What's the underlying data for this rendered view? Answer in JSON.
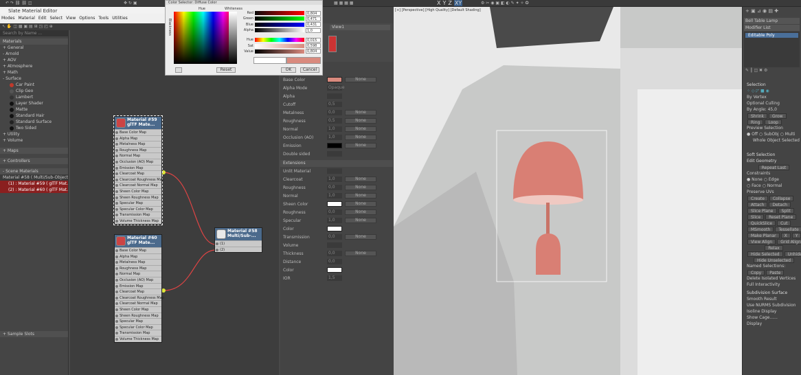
{
  "toolbar": {
    "axes": [
      "X",
      "Y",
      "Z",
      "XY"
    ]
  },
  "window_title": "Slate Material Editor",
  "menu": [
    "Modes",
    "Material",
    "Edit",
    "Select",
    "View",
    "Options",
    "Tools",
    "Utilities"
  ],
  "browser": {
    "search": "Search by Name ...",
    "items": [
      {
        "label": "Materials",
        "type": "section"
      },
      {
        "label": "+ General",
        "type": "item"
      },
      {
        "label": "- Arnold",
        "type": "item"
      },
      {
        "label": "+ AOV",
        "type": "item"
      },
      {
        "label": "+ Atmosphere",
        "type": "item"
      },
      {
        "label": "+ Math",
        "type": "item"
      },
      {
        "label": "- Surface",
        "type": "item"
      },
      {
        "label": "Car Paint",
        "type": "mat",
        "color": "#c0392b"
      },
      {
        "label": "Clip Geo",
        "type": "mat",
        "color": "#555"
      },
      {
        "label": "Lambert",
        "type": "mat",
        "color": "#333"
      },
      {
        "label": "Layer Shader",
        "type": "mat",
        "color": "#111"
      },
      {
        "label": "Matte",
        "type": "mat",
        "color": "#111"
      },
      {
        "label": "Standard Hair",
        "type": "mat",
        "color": "#111"
      },
      {
        "label": "Standard Surface",
        "type": "mat",
        "color": "#222"
      },
      {
        "label": "Two Sided",
        "type": "mat",
        "color": "#111"
      },
      {
        "label": "+ Utility",
        "type": "item"
      },
      {
        "label": "+ Volume",
        "type": "item"
      },
      {
        "label": "+ Maps",
        "type": "section"
      },
      {
        "label": "+ Controllers",
        "type": "section"
      },
      {
        "label": "- Scene Materials",
        "type": "section"
      },
      {
        "label": "Material #58 ( Multi/Sub-Object )",
        "type": "scene"
      },
      {
        "label": "(1) : Material #59 ( glTF Mat...",
        "type": "scene-red"
      },
      {
        "label": "(2) : Material #60 ( glTF Mat...",
        "type": "scene-red"
      }
    ],
    "sample_slots": "+ Sample Slots"
  },
  "view_tab": "View1",
  "color_picker": {
    "title": "Color Selector: Diffuse Color",
    "hue_label": "Hue",
    "whiteness_label": "Whiteness",
    "blackness_label": "Blackness",
    "channels": [
      {
        "name": "Red",
        "value": "0,804"
      },
      {
        "name": "Green",
        "value": "0,471"
      },
      {
        "name": "Blue",
        "value": "0,431"
      },
      {
        "name": "Alpha",
        "value": "1,0"
      },
      {
        "name": "Hue",
        "value": "0,015"
      },
      {
        "name": "Sat",
        "value": "0,598"
      },
      {
        "name": "Value",
        "value": "0,804"
      }
    ],
    "reset": "Reset",
    "ok": "OK",
    "cancel": "Cancel",
    "color": "#d98a7e"
  },
  "nodes": {
    "mat59": {
      "title": "Material #59",
      "subtitle": "glTF Mate...",
      "slots": [
        "Base Color Map",
        "Alpha Map",
        "Metalness Map",
        "Roughness Map",
        "Normal Map",
        "Occlusion (AO) Map",
        "Emission Map",
        "Clearcoat Map",
        "Clearcoat Roughness Map",
        "Clearcoat Normal Map",
        "Sheen Color Map",
        "Sheen Roughness Map",
        "Specular Map",
        "Specular Color Map",
        "Transmission Map",
        "Volume Thickness Map"
      ]
    },
    "mat60": {
      "title": "Material #60",
      "subtitle": "glTF Mate...",
      "slots": [
        "Base Color Map",
        "Alpha Map",
        "Metalness Map",
        "Roughness Map",
        "Normal Map",
        "Occlusion (AO) Map",
        "Emission Map",
        "Clearcoat Map",
        "Clearcoat Roughness Map",
        "Clearcoat Normal Map",
        "Sheen Color Map",
        "Sheen Roughness Map",
        "Specular Map",
        "Specular Color Map",
        "Transmission Map",
        "Volume Thickness Map"
      ]
    },
    "mat58": {
      "title": "Material #58",
      "subtitle": "Multi/Sub-...",
      "slots": [
        "(1)",
        "(2)"
      ]
    }
  },
  "params": {
    "rows": [
      {
        "label": "Base Color",
        "value": "",
        "button": "None",
        "swatch": "#d98a7e"
      },
      {
        "label": "Alpha Mode",
        "value": "Opaque",
        "button": ""
      },
      {
        "label": "Alpha",
        "value": "",
        "button": ""
      },
      {
        "label": "Cutoff",
        "value": "0,5",
        "button": ""
      },
      {
        "label": "Metalness",
        "value": "0,0",
        "button": "None"
      },
      {
        "label": "Roughness",
        "value": "0,5",
        "button": "None"
      },
      {
        "label": "Normal",
        "value": "1,0",
        "button": "None"
      },
      {
        "label": "Occlusion (AO)",
        "value": "1,0",
        "button": "None"
      },
      {
        "label": "Emission",
        "value": "",
        "button": "None",
        "swatch": "#000000"
      },
      {
        "label": "Double sided",
        "value": "",
        "button": ""
      }
    ],
    "extensions": "Extensions",
    "ext_rows": [
      {
        "label": "Unlit Material",
        "value": "",
        "button": ""
      },
      {
        "label": "Clearcoat",
        "value": "1,0",
        "button": "None"
      },
      {
        "label": "Roughness",
        "value": "0,0",
        "button": "None"
      },
      {
        "label": "Normal",
        "value": "1,0",
        "button": "None"
      },
      {
        "label": "Sheen Color",
        "value": "",
        "button": "None",
        "swatch": "#ffffff"
      },
      {
        "label": "Roughness",
        "value": "0,0",
        "button": "None"
      },
      {
        "label": "Specular",
        "value": "1,0",
        "button": "None"
      },
      {
        "label": "Color",
        "value": "",
        "button": "",
        "swatch": "#ffffff"
      },
      {
        "label": "Transmission",
        "value": "0,0",
        "button": "None"
      },
      {
        "label": "Volume",
        "value": "",
        "button": ""
      },
      {
        "label": "Thickness",
        "value": "0,0",
        "button": "None"
      },
      {
        "label": "Distance",
        "value": "0,0",
        "button": ""
      },
      {
        "label": "Color",
        "value": "",
        "button": "",
        "swatch": "#ffffff"
      },
      {
        "label": "IOR",
        "value": "1,5",
        "button": ""
      }
    ]
  },
  "viewport": {
    "label": "[+] [Perspective] [High Quality] [Default Shading]"
  },
  "cmd": {
    "object_name": "Bell Table Lamp",
    "modifier_list": "Modifier List",
    "stack_item": "Editable Poly",
    "selection": "Selection",
    "by_vertex": "By Vertex",
    "ignore_backfacing": "Ignore Backfacing",
    "by_angle": "By Angle: 45,0",
    "optional_culling": "Optional Culling",
    "shrink": "Shrink",
    "grow": "Grow",
    "ring": "Ring",
    "loop": "Loop",
    "preview_selection": "Preview Selection",
    "off": "Off",
    "subobj": "SubObj",
    "multi": "Multi",
    "whole_object": "Whole Object Selected",
    "soft_selection": "Soft Selection",
    "edit_geometry": "Edit Geometry",
    "repeat_last": "Repeat Last",
    "constraints": "Constraints",
    "none": "None",
    "edge": "Edge",
    "face": "Face",
    "normal": "Normal",
    "preserve_uvs": "Preserve UVs",
    "create": "Create",
    "collapse": "Collapse",
    "attach": "Attach",
    "detach": "Detach",
    "slice_plane": "Slice Plane",
    "split": "Split",
    "slice": "Slice",
    "reset_plane": "Reset Plane",
    "quickslice": "QuickSlice",
    "cut": "Cut",
    "msmooth": "MSmooth",
    "tessellate": "Tessellate",
    "make_planar": "Make Planar",
    "x": "X",
    "y": "Y",
    "z": "Z",
    "view_align": "View Align",
    "grid_align": "Grid Align",
    "relax": "Relax",
    "hide_selected": "Hide Selected",
    "unhide_all": "Unhide All",
    "hide_unselected": "Hide Unselected",
    "named_selections": "Named Selections:",
    "copy": "Copy",
    "paste": "Paste",
    "delete_isolated": "Delete Isolated Vertices",
    "full_interactivity": "Full Interactivity",
    "subdivision_surface": "Subdivision Surface",
    "smooth_result": "Smooth Result",
    "use_nurms": "Use NURMS Subdivision",
    "isoline": "Isoline Display",
    "show_cage": "Show Cage......",
    "display": "Display"
  }
}
